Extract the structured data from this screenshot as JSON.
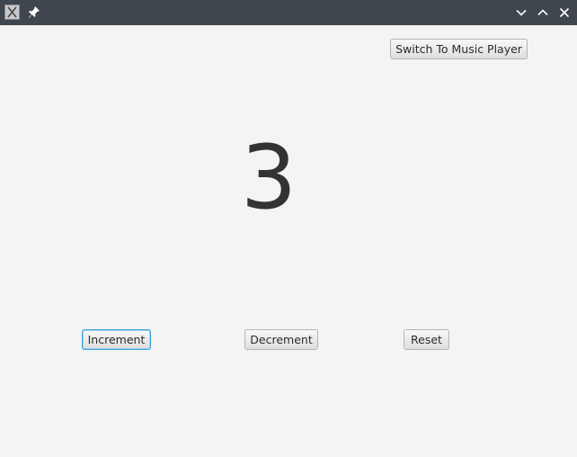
{
  "window": {
    "app_icon": "x-window-icon",
    "pin_icon": "pin-icon",
    "controls": [
      "chevron-down-icon",
      "chevron-up-icon",
      "close-icon"
    ]
  },
  "main": {
    "switch_label": "Switch To Music Player",
    "counter_value": "3",
    "increment_label": "Increment",
    "decrement_label": "Decrement",
    "reset_label": "Reset"
  },
  "colors": {
    "titlebar": "#3f464e",
    "background": "#f4f4f4",
    "focus_ring": "#3aa3dc",
    "counter_text": "#333333"
  }
}
